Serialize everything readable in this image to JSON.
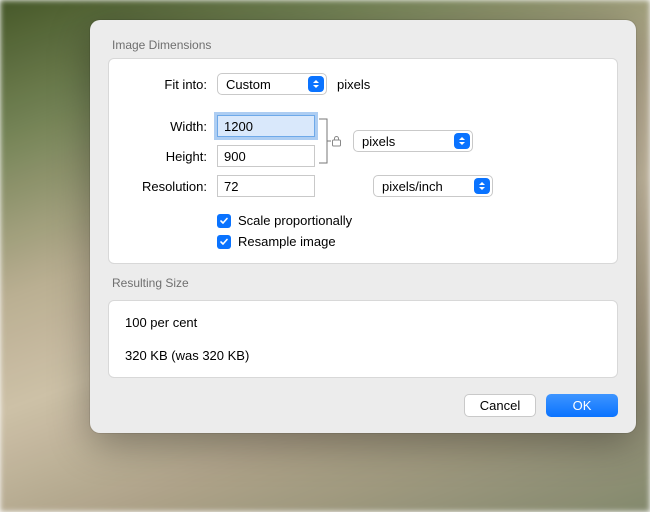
{
  "sections": {
    "dimensions_label": "Image Dimensions",
    "resulting_label": "Resulting Size"
  },
  "fit": {
    "label": "Fit into:",
    "value": "Custom",
    "unit": "pixels"
  },
  "width": {
    "label": "Width:",
    "value": "1200"
  },
  "height": {
    "label": "Height:",
    "value": "900"
  },
  "wh_unit": {
    "value": "pixels"
  },
  "resolution": {
    "label": "Resolution:",
    "value": "72",
    "unit": "pixels/inch"
  },
  "checkboxes": {
    "scale": "Scale proportionally",
    "resample": "Resample image"
  },
  "result": {
    "percent": "100 per cent",
    "size": "320 KB (was 320 KB)"
  },
  "buttons": {
    "cancel": "Cancel",
    "ok": "OK"
  }
}
